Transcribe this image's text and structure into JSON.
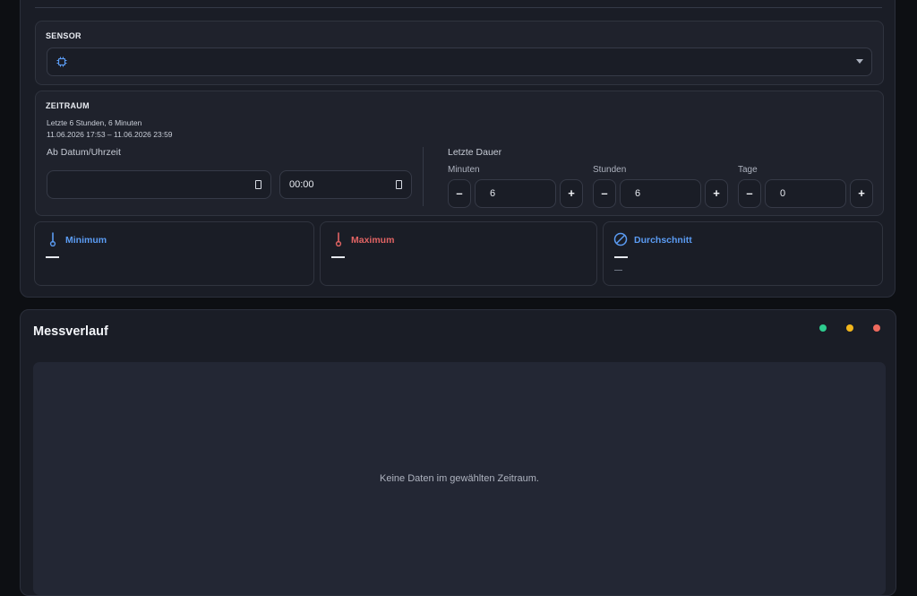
{
  "sensor": {
    "label": "SENSOR",
    "icon": "chip-icon",
    "selected_value": ""
  },
  "zeitraum": {
    "label": "ZEITRAUM",
    "summary": "Letzte 6 Stunden, 6 Minuten",
    "range": "11.06.2026 17:53 – 11.06.2026 23:59",
    "from_label": "Ab Datum/Uhrzeit",
    "date_value": "",
    "time_value": "00:00",
    "duration_label": "Letzte Dauer",
    "minutes": {
      "label": "Minuten",
      "value": "6"
    },
    "hours": {
      "label": "Stunden",
      "value": "6"
    },
    "days": {
      "label": "Tage",
      "value": "0"
    },
    "minus": "–",
    "plus": "+"
  },
  "stats": {
    "minimum": {
      "title": "Minimum",
      "value": "—",
      "color": "#5b9cf4"
    },
    "maximum": {
      "title": "Maximum",
      "value": "—",
      "color": "#e26464"
    },
    "average": {
      "title": "Durchschnitt",
      "value": "—",
      "sub": "—",
      "color": "#5b9cf4"
    }
  },
  "chart": {
    "title": "Messverlauf",
    "empty_message": "Keine Daten im gewählten Zeitraum.",
    "dot_colors": [
      "#2ecc8f",
      "#f2b61c",
      "#ef6a5e"
    ]
  }
}
